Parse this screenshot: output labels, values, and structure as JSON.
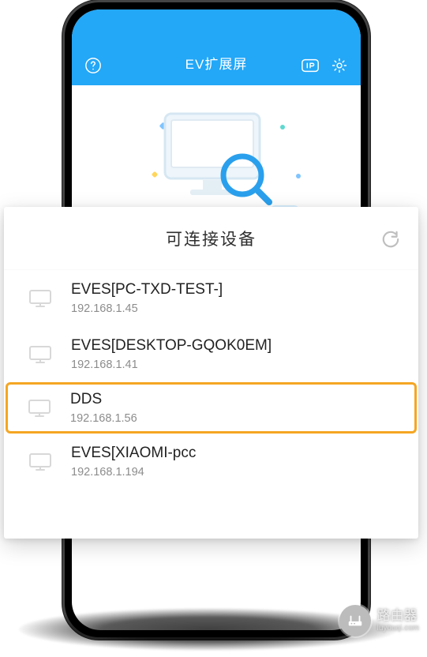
{
  "app": {
    "title": "EV扩展屏"
  },
  "modal": {
    "title": "可连接设备"
  },
  "devices": [
    {
      "name": "EVES[PC-TXD-TEST-]",
      "ip": "192.168.1.45",
      "highlight": false
    },
    {
      "name": "EVES[DESKTOP-GQOK0EM]",
      "ip": "192.168.1.41",
      "highlight": false
    },
    {
      "name": "DDS",
      "ip": "192.168.1.56",
      "highlight": true
    },
    {
      "name": "EVES[XIAOMI-pcc",
      "ip": "192.168.1.194",
      "highlight": false
    }
  ],
  "watermark": {
    "title": "路由器",
    "sub": "luyouqi.com"
  },
  "colors": {
    "accent": "#23a7f7",
    "highlight_border": "#f5a623"
  }
}
